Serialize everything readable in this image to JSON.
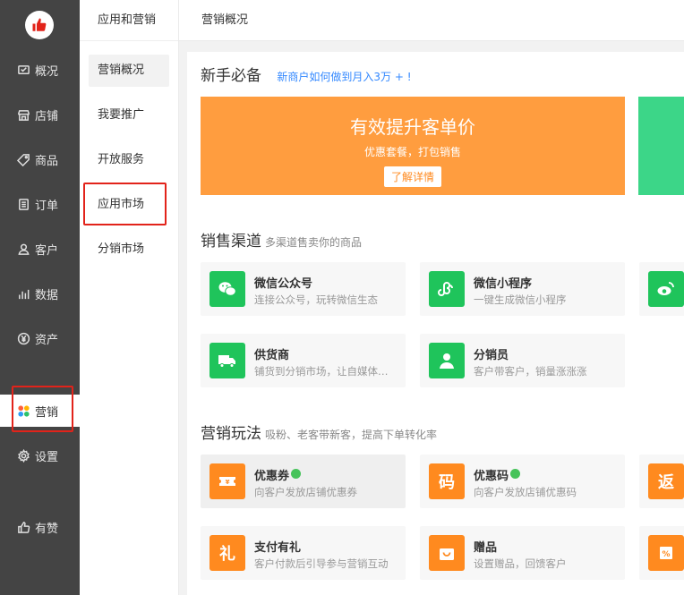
{
  "nav1": {
    "items": [
      {
        "label": "概况",
        "icon": "overview-icon"
      },
      {
        "label": "店铺",
        "icon": "store-icon"
      },
      {
        "label": "商品",
        "icon": "tag-icon"
      },
      {
        "label": "订单",
        "icon": "order-icon"
      },
      {
        "label": "客户",
        "icon": "user-icon"
      },
      {
        "label": "数据",
        "icon": "chart-icon"
      },
      {
        "label": "资产",
        "icon": "yen-icon"
      },
      {
        "label": "营销",
        "icon": "marketing-icon"
      },
      {
        "label": "设置",
        "icon": "gear-icon"
      },
      {
        "label": "有赞",
        "icon": "thumb-icon"
      }
    ]
  },
  "nav2": {
    "title": "应用和营销",
    "items": [
      {
        "label": "营销概况"
      },
      {
        "label": "我要推广"
      },
      {
        "label": "开放服务"
      },
      {
        "label": "应用市场"
      },
      {
        "label": "分销市场"
      }
    ]
  },
  "header": {
    "title": "营销概况"
  },
  "newbie": {
    "title": "新手必备",
    "link": "新商户如何做到月入3万 + !",
    "banner_title": "有效提升客单价",
    "banner_sub": "优惠套餐，打包销售",
    "banner_button": "了解详情"
  },
  "channels": {
    "title": "销售渠道",
    "sub": "多渠道售卖你的商品",
    "cards": [
      {
        "title": "微信公众号",
        "desc": "连接公众号，玩转微信生态"
      },
      {
        "title": "微信小程序",
        "desc": "一键生成微信小程序"
      },
      {
        "title": "供货商",
        "desc": "铺货到分销市场，让自媒体帮你卖货"
      },
      {
        "title": "分销员",
        "desc": "客户带客户，销量涨涨涨"
      }
    ]
  },
  "marketing": {
    "title": "营销玩法",
    "sub": "吸粉、老客带新客，提高下单转化率",
    "cards": [
      {
        "title": "优惠券",
        "desc": "向客户发放店铺优惠券",
        "icon_text": "¥"
      },
      {
        "title": "优惠码",
        "desc": "向客户发放店铺优惠码",
        "icon_text": "码"
      },
      {
        "title": "支付有礼",
        "desc": "客户付款后引导参与营销互动",
        "icon_text": "礼"
      },
      {
        "title": "赠品",
        "desc": "设置赠品，回馈客户",
        "icon_text": ""
      }
    ],
    "edge_icons": [
      "返",
      "%"
    ]
  },
  "colors": {
    "accent_green": "#1fc45b",
    "accent_orange": "#ff8a1f",
    "banner_orange": "#ff9d3f",
    "link_blue": "#3388ff",
    "highlight_red": "#e2231a"
  }
}
